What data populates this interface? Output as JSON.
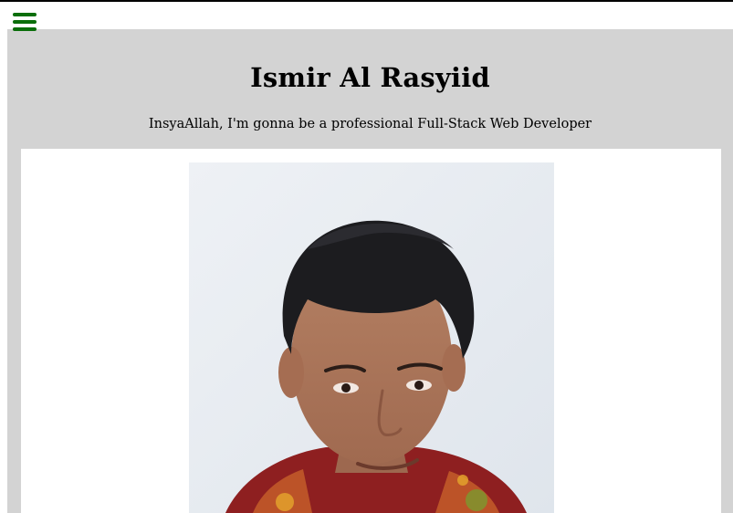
{
  "nav": {
    "menu_icon": "hamburger-menu-icon",
    "menu_color": "#0b6e0b"
  },
  "header": {
    "title": "Ismir Al Rasyiid",
    "tagline": "InsyaAllah, I'm gonna be a professional Full-Stack Web Developer",
    "background": "#d3d3d3"
  },
  "profile": {
    "photo_alt": "Ismir Al Rasyiid"
  }
}
